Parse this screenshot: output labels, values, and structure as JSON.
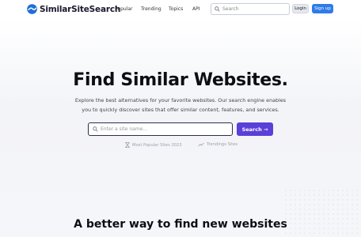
{
  "header": {
    "brand": "SimilarSiteSearch",
    "nav": [
      "Popular",
      "Trending",
      "Topics",
      "API"
    ],
    "search_placeholder": "Search",
    "login_label": "Login",
    "signup_label": "Sign up"
  },
  "hero": {
    "title": "Find Similar Websites.",
    "description": "Explore the best alternatives for your favorite websites. Our search engine enables you to quickly discover sites that offer similar content, features, and services.",
    "search_placeholder": "Enter a site name...",
    "search_button": "Search →",
    "links": [
      "Most Popular Sites 2023",
      "Trendings Sites"
    ]
  },
  "section": {
    "title": "A better way to find new websites"
  },
  "colors": {
    "accent": "#5a3fd8",
    "signup": "#2f7ce8"
  }
}
